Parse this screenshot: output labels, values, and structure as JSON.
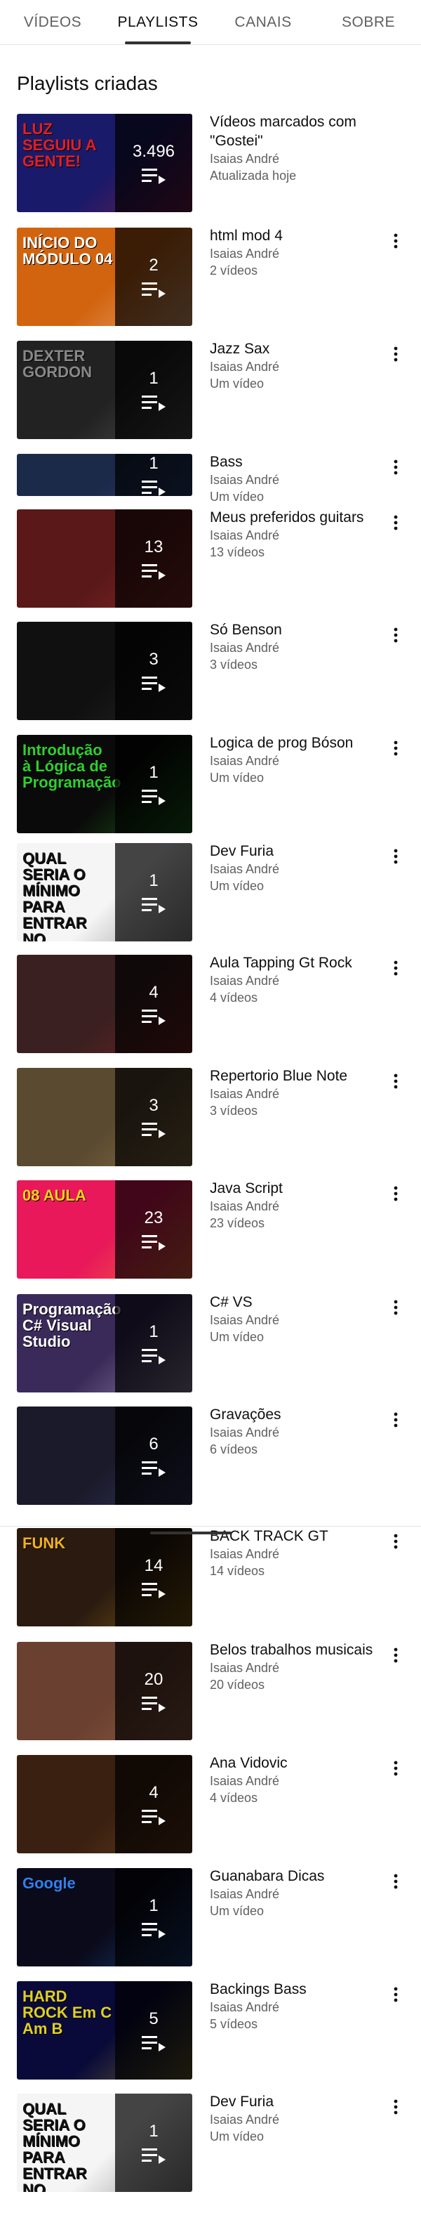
{
  "tabs": [
    {
      "label": "VÍDEOS",
      "active": false
    },
    {
      "label": "PLAYLISTS",
      "active": true
    },
    {
      "label": "CANAIS",
      "active": false
    },
    {
      "label": "SOBRE",
      "active": false
    }
  ],
  "section_title": "Playlists criadas",
  "playlists": [
    {
      "title": "Vídeos marcados com \"Gostei\"",
      "author": "Isaias André",
      "info": "Atualizada hoje",
      "count": "3.496",
      "has_menu": false,
      "art": "LUZ SEGUIU A GENTE!",
      "bg": "#1a1a6a",
      "accent": "#e02020"
    },
    {
      "title": "html mod 4",
      "author": "Isaias André",
      "info": "2 vídeos",
      "count": "2",
      "has_menu": true,
      "art": "INÍCIO DO MÓDULO 04",
      "bg": "#d2640f",
      "accent": "#ffffff"
    },
    {
      "title": "Jazz Sax",
      "author": "Isaias André",
      "info": "Um vídeo",
      "count": "1",
      "has_menu": true,
      "art": "DEXTER GORDON",
      "bg": "#222222",
      "accent": "#888888"
    },
    {
      "title": "Bass",
      "author": "Isaias André",
      "info": "Um vídeo",
      "count": "1",
      "has_menu": true,
      "art": "",
      "bg": "#1c2a4a",
      "accent": "#3a5da0"
    },
    {
      "title": "Meus preferidos guitars",
      "author": "Isaias André",
      "info": "13 vídeos",
      "count": "13",
      "has_menu": true,
      "art": "",
      "bg": "#5a1818",
      "accent": "#c04040"
    },
    {
      "title": "Só Benson",
      "author": "Isaias André",
      "info": "3 vídeos",
      "count": "3",
      "has_menu": true,
      "art": "",
      "bg": "#101010",
      "accent": "#444444"
    },
    {
      "title": "Logica  de prog Bóson",
      "author": "Isaias André",
      "info": "Um vídeo",
      "count": "1",
      "has_menu": true,
      "art": "Introdução à Lógica de Programação",
      "bg": "#0a0a0a",
      "accent": "#2ed02e"
    },
    {
      "title": "Dev Furia",
      "author": "Isaias André",
      "info": "Um vídeo",
      "count": "1",
      "has_menu": true,
      "art": "QUAL SERIA O MÍNIMO PARA ENTRAR NO MERCADO COMO UM JUNIOR ?",
      "bg": "#f5f5f5",
      "accent": "#111111"
    },
    {
      "title": "Aula Tapping Gt Rock",
      "author": "Isaias André",
      "info": "4 vídeos",
      "count": "4",
      "has_menu": true,
      "art": "",
      "bg": "#3a2020",
      "accent": "#c02020"
    },
    {
      "title": "Repertorio Blue Note",
      "author": "Isaias André",
      "info": "3 vídeos",
      "count": "3",
      "has_menu": true,
      "art": "",
      "bg": "#5a4a30",
      "accent": "#c8a060"
    },
    {
      "title": "Java Script",
      "author": "Isaias André",
      "info": "23 vídeos",
      "count": "23",
      "has_menu": true,
      "art": "08 AULA",
      "bg": "#e8185a",
      "accent": "#ffd21a"
    },
    {
      "title": "C# VS",
      "author": "Isaias André",
      "info": "Um vídeo",
      "count": "1",
      "has_menu": true,
      "art": "Programação C# Visual Studio",
      "bg": "#3a2a5a",
      "accent": "#ffffff"
    },
    {
      "title": "Gravações",
      "author": "Isaias André",
      "info": "6 vídeos",
      "count": "6",
      "has_menu": true,
      "art": "",
      "bg": "#1a1a2a",
      "accent": "#5060a0"
    },
    {
      "title": "BACK TRACK GT",
      "author": "Isaias André",
      "info": "14 vídeos",
      "count": "14",
      "has_menu": true,
      "art": "FUNK",
      "bg": "#2a1a10",
      "accent": "#f0b020"
    },
    {
      "title": "Belos trabalhos musicais",
      "author": "Isaias André",
      "info": "20 vídeos",
      "count": "20",
      "has_menu": true,
      "art": "",
      "bg": "#6a4030",
      "accent": "#c08060"
    },
    {
      "title": "Ana Vidovic",
      "author": "Isaias André",
      "info": "4 vídeos",
      "count": "4",
      "has_menu": true,
      "art": "",
      "bg": "#3a2010",
      "accent": "#a06030"
    },
    {
      "title": "Guanabara Dicas",
      "author": "Isaias André",
      "info": "Um vídeo",
      "count": "1",
      "has_menu": true,
      "art": "Google",
      "bg": "#0a0a1a",
      "accent": "#3080f0"
    },
    {
      "title": "Backings Bass",
      "author": "Isaias André",
      "info": "5 vídeos",
      "count": "5",
      "has_menu": true,
      "art": "HARD ROCK Em C Am B",
      "bg": "#0a0a3a",
      "accent": "#e0d020"
    },
    {
      "title": "Dev Furia",
      "author": "Isaias André",
      "info": "Um vídeo",
      "count": "1",
      "has_menu": true,
      "art": "QUAL SERIA O MÍNIMO PARA ENTRAR NO MERCADO COMO UM JUNIOR ?",
      "bg": "#f5f5f5",
      "accent": "#111111"
    }
  ]
}
